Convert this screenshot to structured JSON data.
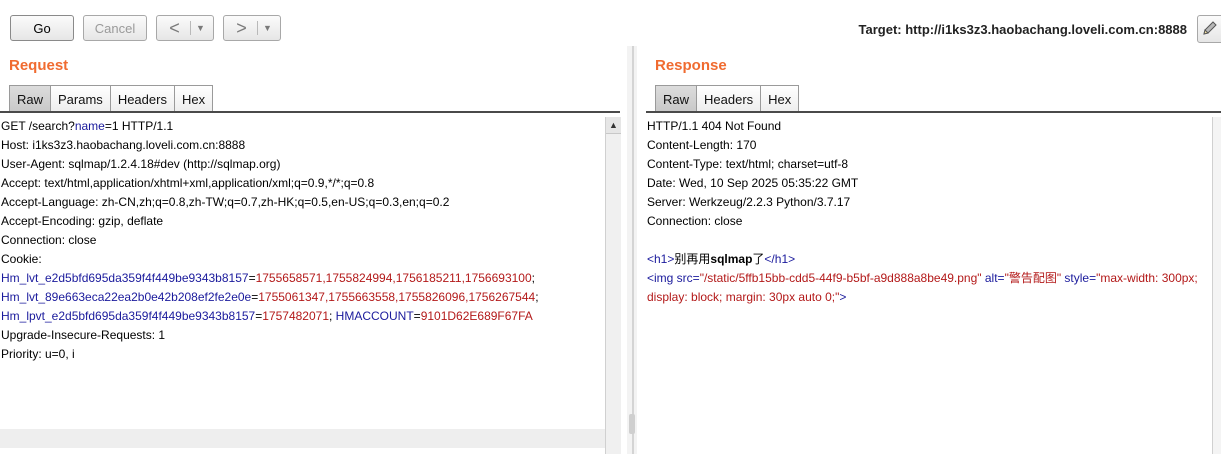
{
  "toolbar": {
    "go_label": "Go",
    "cancel_label": "Cancel",
    "back_glyph": "<",
    "forward_glyph": ">",
    "dropdown_glyph": "▼",
    "target_text": "Target: http://i1ks3z3.haobachang.loveli.com.cn:8888",
    "edit_icon": "pencil-icon"
  },
  "request": {
    "title": "Request",
    "tabs": [
      "Raw",
      "Params",
      "Headers",
      "Hex"
    ],
    "active_tab": "Raw",
    "lines": {
      "l1a": "GET /search?",
      "l1b": "name",
      "l1c": "=",
      "l1d": "1",
      "l1e": " HTTP/1.1",
      "l2": "Host: i1ks3z3.haobachang.loveli.com.cn:8888",
      "l3": "User-Agent: sqlmap/1.2.4.18#dev (http://sqlmap.org)",
      "l4": "Accept: text/html,application/xhtml+xml,application/xml;q=0.9,*/*;q=0.8",
      "l5": "Accept-Language: zh-CN,zh;q=0.8,zh-TW;q=0.7,zh-HK;q=0.5,en-US;q=0.3,en;q=0.2",
      "l6": "Accept-Encoding: gzip, deflate",
      "l7": "Connection: close",
      "l8": "Cookie:",
      "c1k": "Hm_lvt_e2d5bfd695da359f4f449be9343b8157",
      "c1v": "1755658571,1755824994,1756185211,1756693100",
      "c2k": "Hm_lvt_89e663eca22ea2b0e42b208ef2fe2e0e",
      "c2v": "1755061347,1755663558,1755826096,1756267544",
      "c3k": "Hm_lpvt_e2d5bfd695da359f4f449be9343b8157",
      "c3v": "1757482071",
      "c4k": "HMACCOUNT",
      "c4v": "9101D62E689F67FA",
      "l12": "Upgrade-Insecure-Requests: 1",
      "l13": "Priority: u=0, i"
    }
  },
  "response": {
    "title": "Response",
    "tabs": [
      "Raw",
      "Headers",
      "Hex"
    ],
    "active_tab": "Raw",
    "lines": {
      "l1": "HTTP/1.1 404 Not Found",
      "l2": "Content-Length: 170",
      "l3": "Content-Type: text/html; charset=utf-8",
      "l4": "Date: Wed, 10 Sep 2025 05:35:22 GMT",
      "l5": "Server: Werkzeug/2.2.3 Python/3.7.17",
      "l6": "Connection: close",
      "h1_open": "<h1>",
      "h1_text_a": "别再用",
      "h1_text_b": "sqlmap",
      "h1_text_c": "了",
      "h1_close": "</h1>",
      "img_open": "<img src=",
      "img_src": "\"/static/5ffb15bb-cdd5-44f9-b5bf-a9d888a8be49.png\"",
      "img_alt_attr": " alt=",
      "img_alt": "\"警告配图\"",
      "img_style_attr": " style=",
      "img_style": "\"max-width: 300px; display: block; margin: 30px auto 0;\"",
      "img_close": ">"
    }
  },
  "colors": {
    "title_orange": "#f06b30",
    "key_blue": "#1a1a9c",
    "value_red": "#b31919"
  }
}
